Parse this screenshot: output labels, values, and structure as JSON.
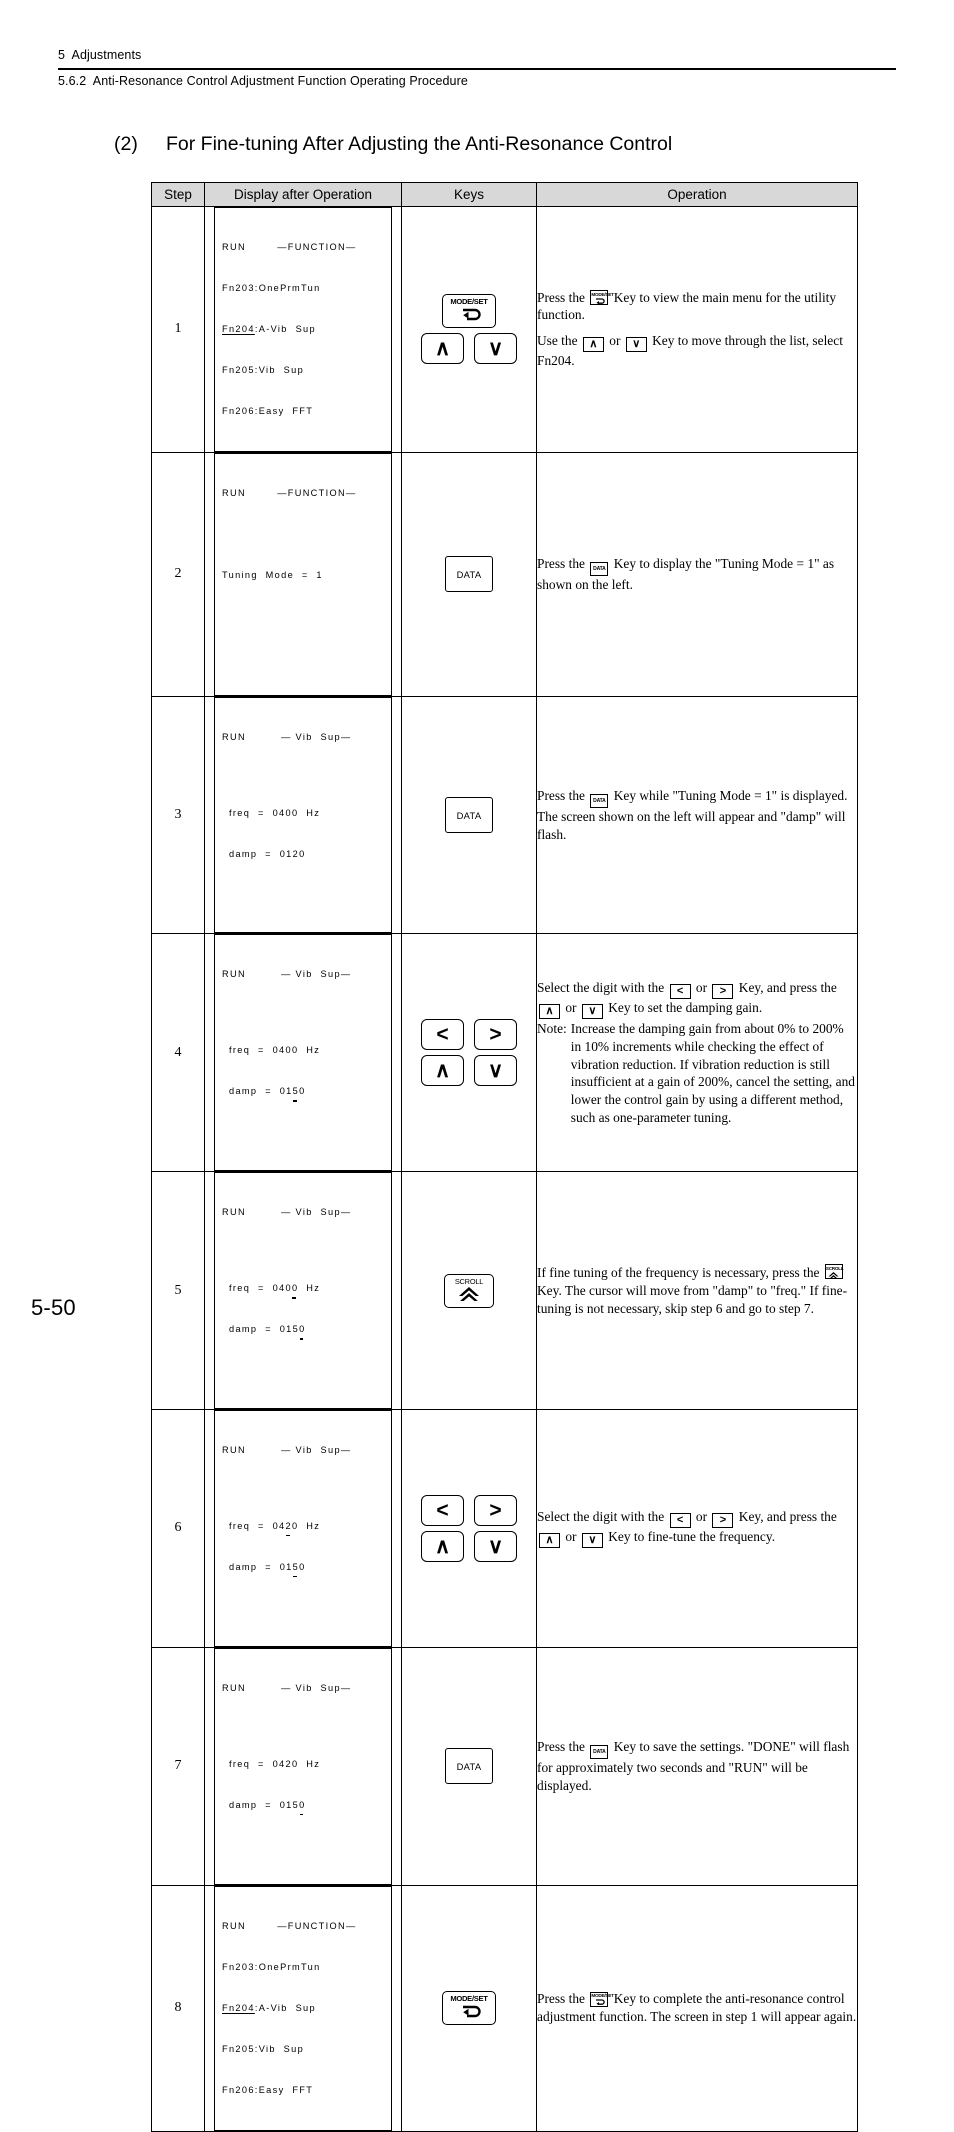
{
  "header": {
    "chapter": "5  Adjustments",
    "section": "5.6.2  Anti-Resonance Control Adjustment Function Operating Procedure"
  },
  "section_title": {
    "number": "(2)",
    "text": "For Fine-tuning After Adjusting the Anti-Resonance Control"
  },
  "table": {
    "columns": [
      "Step",
      "Display after Operation",
      "Keys",
      "Operation"
    ],
    "rows": [
      {
        "step": "1",
        "display": {
          "lines": [
            "RUN        —FUNCTION—",
            "Fn203:OnePrmTun",
            "Fn204:A-Vib  Sup",
            "Fn205:Vib  Sup",
            "Fn206:Easy  FFT"
          ],
          "underlined_line_index": 2
        },
        "keys": [
          "mode-set",
          "up",
          "down"
        ],
        "operation": {
          "paragraph_1_before": "Press the",
          "paragraph_1_after": "Key to view the main menu for the utility function.",
          "paragraph_2_before": "Use the",
          "paragraph_2_middle": "or",
          "paragraph_2_after": "Key to move through the list, select Fn204."
        }
      },
      {
        "step": "2",
        "display": {
          "lines": [
            "RUN        —FUNCTION—",
            "",
            "Tuning  Mode  =  1"
          ]
        },
        "keys": [
          "data"
        ],
        "operation": {
          "before": "Press the",
          "after": "Key to display the \"Tuning Mode = 1\" as shown on the left."
        }
      },
      {
        "step": "3",
        "display": {
          "lines": [
            "RUN         — Vib  Sup—",
            "",
            "freq  =  0400  Hz",
            "damp  =  0120"
          ]
        },
        "keys": [
          "data"
        ],
        "operation": {
          "before": "Press the",
          "after": "Key while  \"Tuning Mode = 1\" is displayed. The screen shown on the left will appear and \"damp\" will flash."
        }
      },
      {
        "step": "4",
        "display": {
          "lines": [
            "RUN         — Vib  Sup—",
            "",
            "freq  =  0400  Hz",
            "damp  =  0150"
          ],
          "cursor_note": "underline under third digit of damp value"
        },
        "keys": [
          "left",
          "right",
          "up",
          "down"
        ],
        "operation": {
          "line1_a": "Select the digit with the",
          "line1_b": "or",
          "line1_c": "Key, and press the",
          "line1_d": "or",
          "line1_e": "Key to set the damping gain.",
          "note_label": "Note:",
          "note_text": "Increase the damping gain from about 0% to 200% in 10% increments while checking the effect of vibration reduction. If vibration reduction is still insufficient at a gain of 200%, cancel the setting, and lower the control gain by using a different method, such as one-parameter tuning."
        }
      },
      {
        "step": "5",
        "display": {
          "lines": [
            "RUN         — Vib  Sup—",
            "",
            "freq  =  0400  Hz",
            "damp  =  0150"
          ],
          "cursor_note": "underline under fourth digit of freq and fourth digit of damp"
        },
        "keys": [
          "scroll"
        ],
        "operation": {
          "before": "If fine tuning of the frequency is necessary, press the",
          "after": "Key. The cursor will move from \"damp\" to \"freq.\" If fine-tuning is not necessary, skip step 6 and go to step 7."
        }
      },
      {
        "step": "6",
        "display": {
          "lines": [
            "RUN         — Vib  Sup—",
            "",
            "freq  =  0420  Hz",
            "damp  =  0150"
          ],
          "cursor_note": "underline under third digit of freq and third digit of damp"
        },
        "keys": [
          "left",
          "right",
          "up",
          "down"
        ],
        "operation": {
          "line1_a": "Select the digit with the",
          "line1_b": "or",
          "line1_c": "Key, and press the",
          "line1_d": "or",
          "line1_e": "Key to fine-tune the frequency."
        }
      },
      {
        "step": "7",
        "display": {
          "lines": [
            "RUN         — Vib  Sup—",
            "",
            "freq  =  0420  Hz",
            "damp  =  0150"
          ],
          "cursor_note": "underline under fourth digit of damp"
        },
        "keys": [
          "data"
        ],
        "operation": {
          "before": "Press the",
          "after": "Key to save the settings. \"DONE\" will flash for approximately two seconds and \"RUN\" will be displayed."
        }
      },
      {
        "step": "8",
        "display": {
          "lines": [
            "RUN        —FUNCTION—",
            "Fn203:OnePrmTun",
            "Fn204:A-Vib  Sup",
            "Fn205:Vib  Sup",
            "Fn206:Easy  FFT"
          ],
          "underlined_line_index": 2
        },
        "keys": [
          "mode-set"
        ],
        "operation": {
          "before": "Press the",
          "after": "Key to complete the anti-resonance control adjustment function. The screen in step 1 will appear again."
        }
      }
    ]
  },
  "keys": {
    "mode_set_label": "MODE/SET",
    "data_label": "DATA",
    "scroll_label": "SCROLL",
    "up_glyph": "∧",
    "down_glyph": "∨",
    "left_glyph": "<",
    "right_glyph": ">"
  },
  "lcd_text": {
    "row1_l1_a": "RUN",
    "row1_l1_b": "—FUNCTION—",
    "row1_l2": "Fn203:OnePrmTun",
    "row1_l3": "Fn204",
    "row1_l3b": ":A-Vib  Sup",
    "row1_l4": "Fn205:Vib  Sup",
    "row1_l5": "Fn206:Easy  FFT",
    "row2_l1_a": "RUN",
    "row2_l1_b": "—FUNCTION—",
    "row2_l2": "Tuning  Mode  =  1",
    "vib_a": "RUN",
    "vib_b": "— Vib  Sup—",
    "freq_label": "freq  =  ",
    "damp_label": "damp  =  ",
    "hz": "  Hz",
    "f0400": "0400",
    "f0420": "0420",
    "d0120": "0120",
    "d0150": "0150",
    "d01": "01",
    "d5": "5",
    "d0": "0",
    "f04": "04",
    "f2": "2",
    "f0_tail": "0",
    "f040": "040",
    "f0_last": "0",
    "d015": "015",
    "d0_last": "0"
  },
  "page_number": "5-50"
}
